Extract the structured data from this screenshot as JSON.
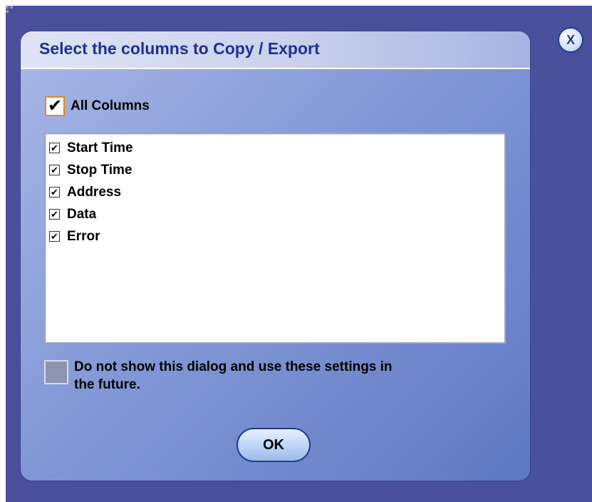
{
  "dialog": {
    "title": "Select the columns to Copy / Export",
    "all_columns": {
      "label": "All Columns",
      "checked": true,
      "check_glyph": "✔"
    },
    "columns": [
      {
        "label": "Start Time",
        "checked": true,
        "check_glyph": "✔"
      },
      {
        "label": "Stop Time",
        "checked": true,
        "check_glyph": "✔"
      },
      {
        "label": "Address",
        "checked": true,
        "check_glyph": "✔"
      },
      {
        "label": "Data",
        "checked": true,
        "check_glyph": "✔"
      },
      {
        "label": "Error",
        "checked": true,
        "check_glyph": "✔"
      }
    ],
    "dont_show": {
      "label": "Do not show this dialog and use these settings in the future.",
      "checked": false
    },
    "ok_label": "OK",
    "close_label": "X"
  },
  "colors": {
    "window_bg": "#4a4f9c",
    "title_text": "#1f2f8f",
    "accent_checkbox_border": "#e08a1e",
    "button_border": "#1c3c8a"
  },
  "icons": {
    "close": "close-icon",
    "resize": "resize-grip-icon"
  }
}
